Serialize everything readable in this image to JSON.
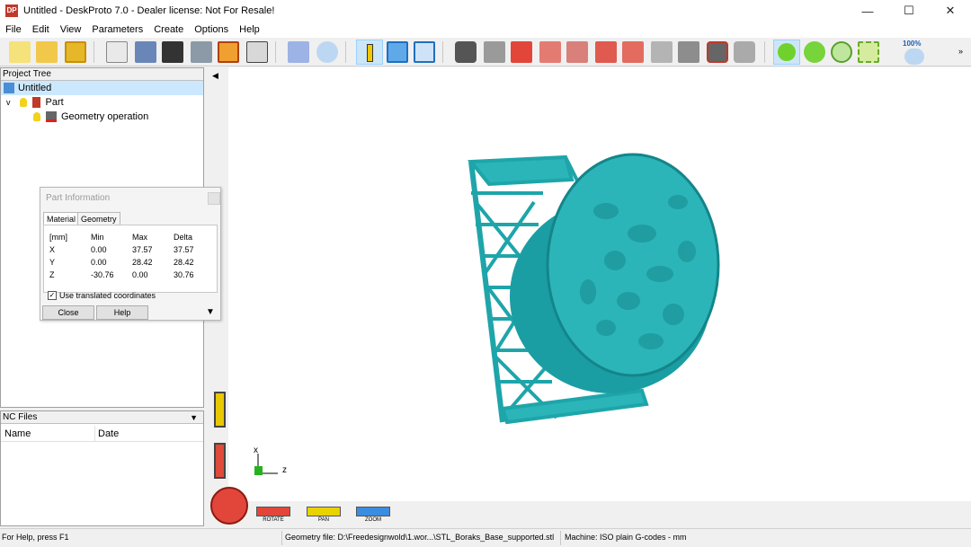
{
  "app": {
    "title": "Untitled - DeskProto 7.0 - Dealer license: Not For Resale!",
    "icon_text": "DP",
    "window_controls": [
      "minimize-icon",
      "maximize-icon",
      "close-icon"
    ]
  },
  "menu": [
    "File",
    "Edit",
    "View",
    "Parameters",
    "Create",
    "Options",
    "Help"
  ],
  "toolbar": {
    "zoom_percent": "100%",
    "colors": {
      "accent": "#0078d7",
      "model": "#2bb5b8",
      "selected_bg": "#cde6f7"
    }
  },
  "project_tree": {
    "title": "Project Tree",
    "items": [
      {
        "label": "Untitled",
        "icon": "project-icon"
      },
      {
        "label": "Part",
        "icon": "part-icon",
        "expander": "v"
      },
      {
        "label": "Geometry operation",
        "icon": "geometry-operation-icon"
      }
    ]
  },
  "part_info": {
    "title": "Part Information",
    "tabs": [
      "Material",
      "Geometry"
    ],
    "header": [
      "[mm]",
      "Min",
      "Max",
      "Delta"
    ],
    "rows": [
      [
        "X",
        "0.00",
        "37.57",
        "37.57"
      ],
      [
        "Y",
        "0.00",
        "28.42",
        "28.42"
      ],
      [
        "Z",
        "-30.76",
        "0.00",
        "30.76"
      ]
    ],
    "checkbox_label": "Use translated coordinates",
    "checkbox_checked": true,
    "close_label": "Close",
    "help_label": "Help"
  },
  "nc_files": {
    "title": "NC Files",
    "columns": [
      "Name",
      "Date"
    ]
  },
  "viewport": {
    "axis_x": "x",
    "axis_z": "z",
    "nav_buttons": [
      "ROTATE",
      "PAN",
      "ZOOM"
    ]
  },
  "status": {
    "help": "For Help, press F1",
    "geometry_file": "Geometry file: D:\\Freedesignwold\\1.wor...\\STL_Boraks_Base_supported.stl",
    "machine": "Machine: ISO plain G-codes - mm"
  }
}
